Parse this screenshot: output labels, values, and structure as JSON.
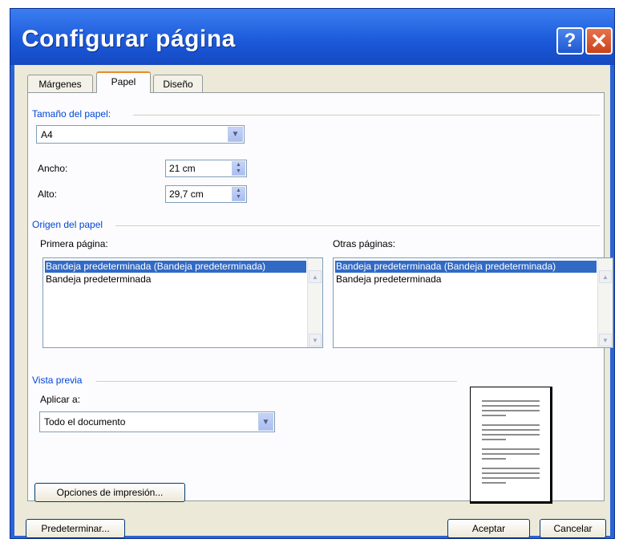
{
  "dialog": {
    "title": "Configurar página",
    "help_symbol": "?",
    "close_symbol": "✕"
  },
  "tabs": [
    {
      "label": "Márgenes",
      "active": false
    },
    {
      "label": "Papel",
      "active": true
    },
    {
      "label": "Diseño",
      "active": false
    }
  ],
  "paper_size": {
    "group_label": "Tamaño del papel:",
    "selected": "A4",
    "width_label": "Ancho:",
    "width_value": "21 cm",
    "height_label": "Alto:",
    "height_value": "29,7 cm"
  },
  "paper_source": {
    "group_label": "Origen del papel",
    "first_page_label": "Primera página:",
    "first_page_items": [
      "Bandeja predeterminada (Bandeja predeterminada)",
      "Bandeja predeterminada"
    ],
    "other_pages_label": "Otras páginas:",
    "other_pages_items": [
      "Bandeja predeterminada (Bandeja predeterminada)",
      "Bandeja predeterminada"
    ]
  },
  "preview": {
    "group_label": "Vista previa",
    "apply_to_label": "Aplicar a:",
    "apply_to_selected": "Todo el documento"
  },
  "buttons": {
    "print_options": "Opciones de impresión...",
    "default": "Predeterminar...",
    "ok": "Aceptar",
    "cancel": "Cancelar"
  },
  "colors": {
    "titlebar": "#2a63d6",
    "group_label": "#0046d5",
    "selection": "#316ac5",
    "dialog_face": "#ece9d8"
  },
  "icons": {
    "dropdown": "chevron-down-icon",
    "spinner": "spinner-arrows-icon",
    "help": "help-icon",
    "close": "close-icon"
  }
}
